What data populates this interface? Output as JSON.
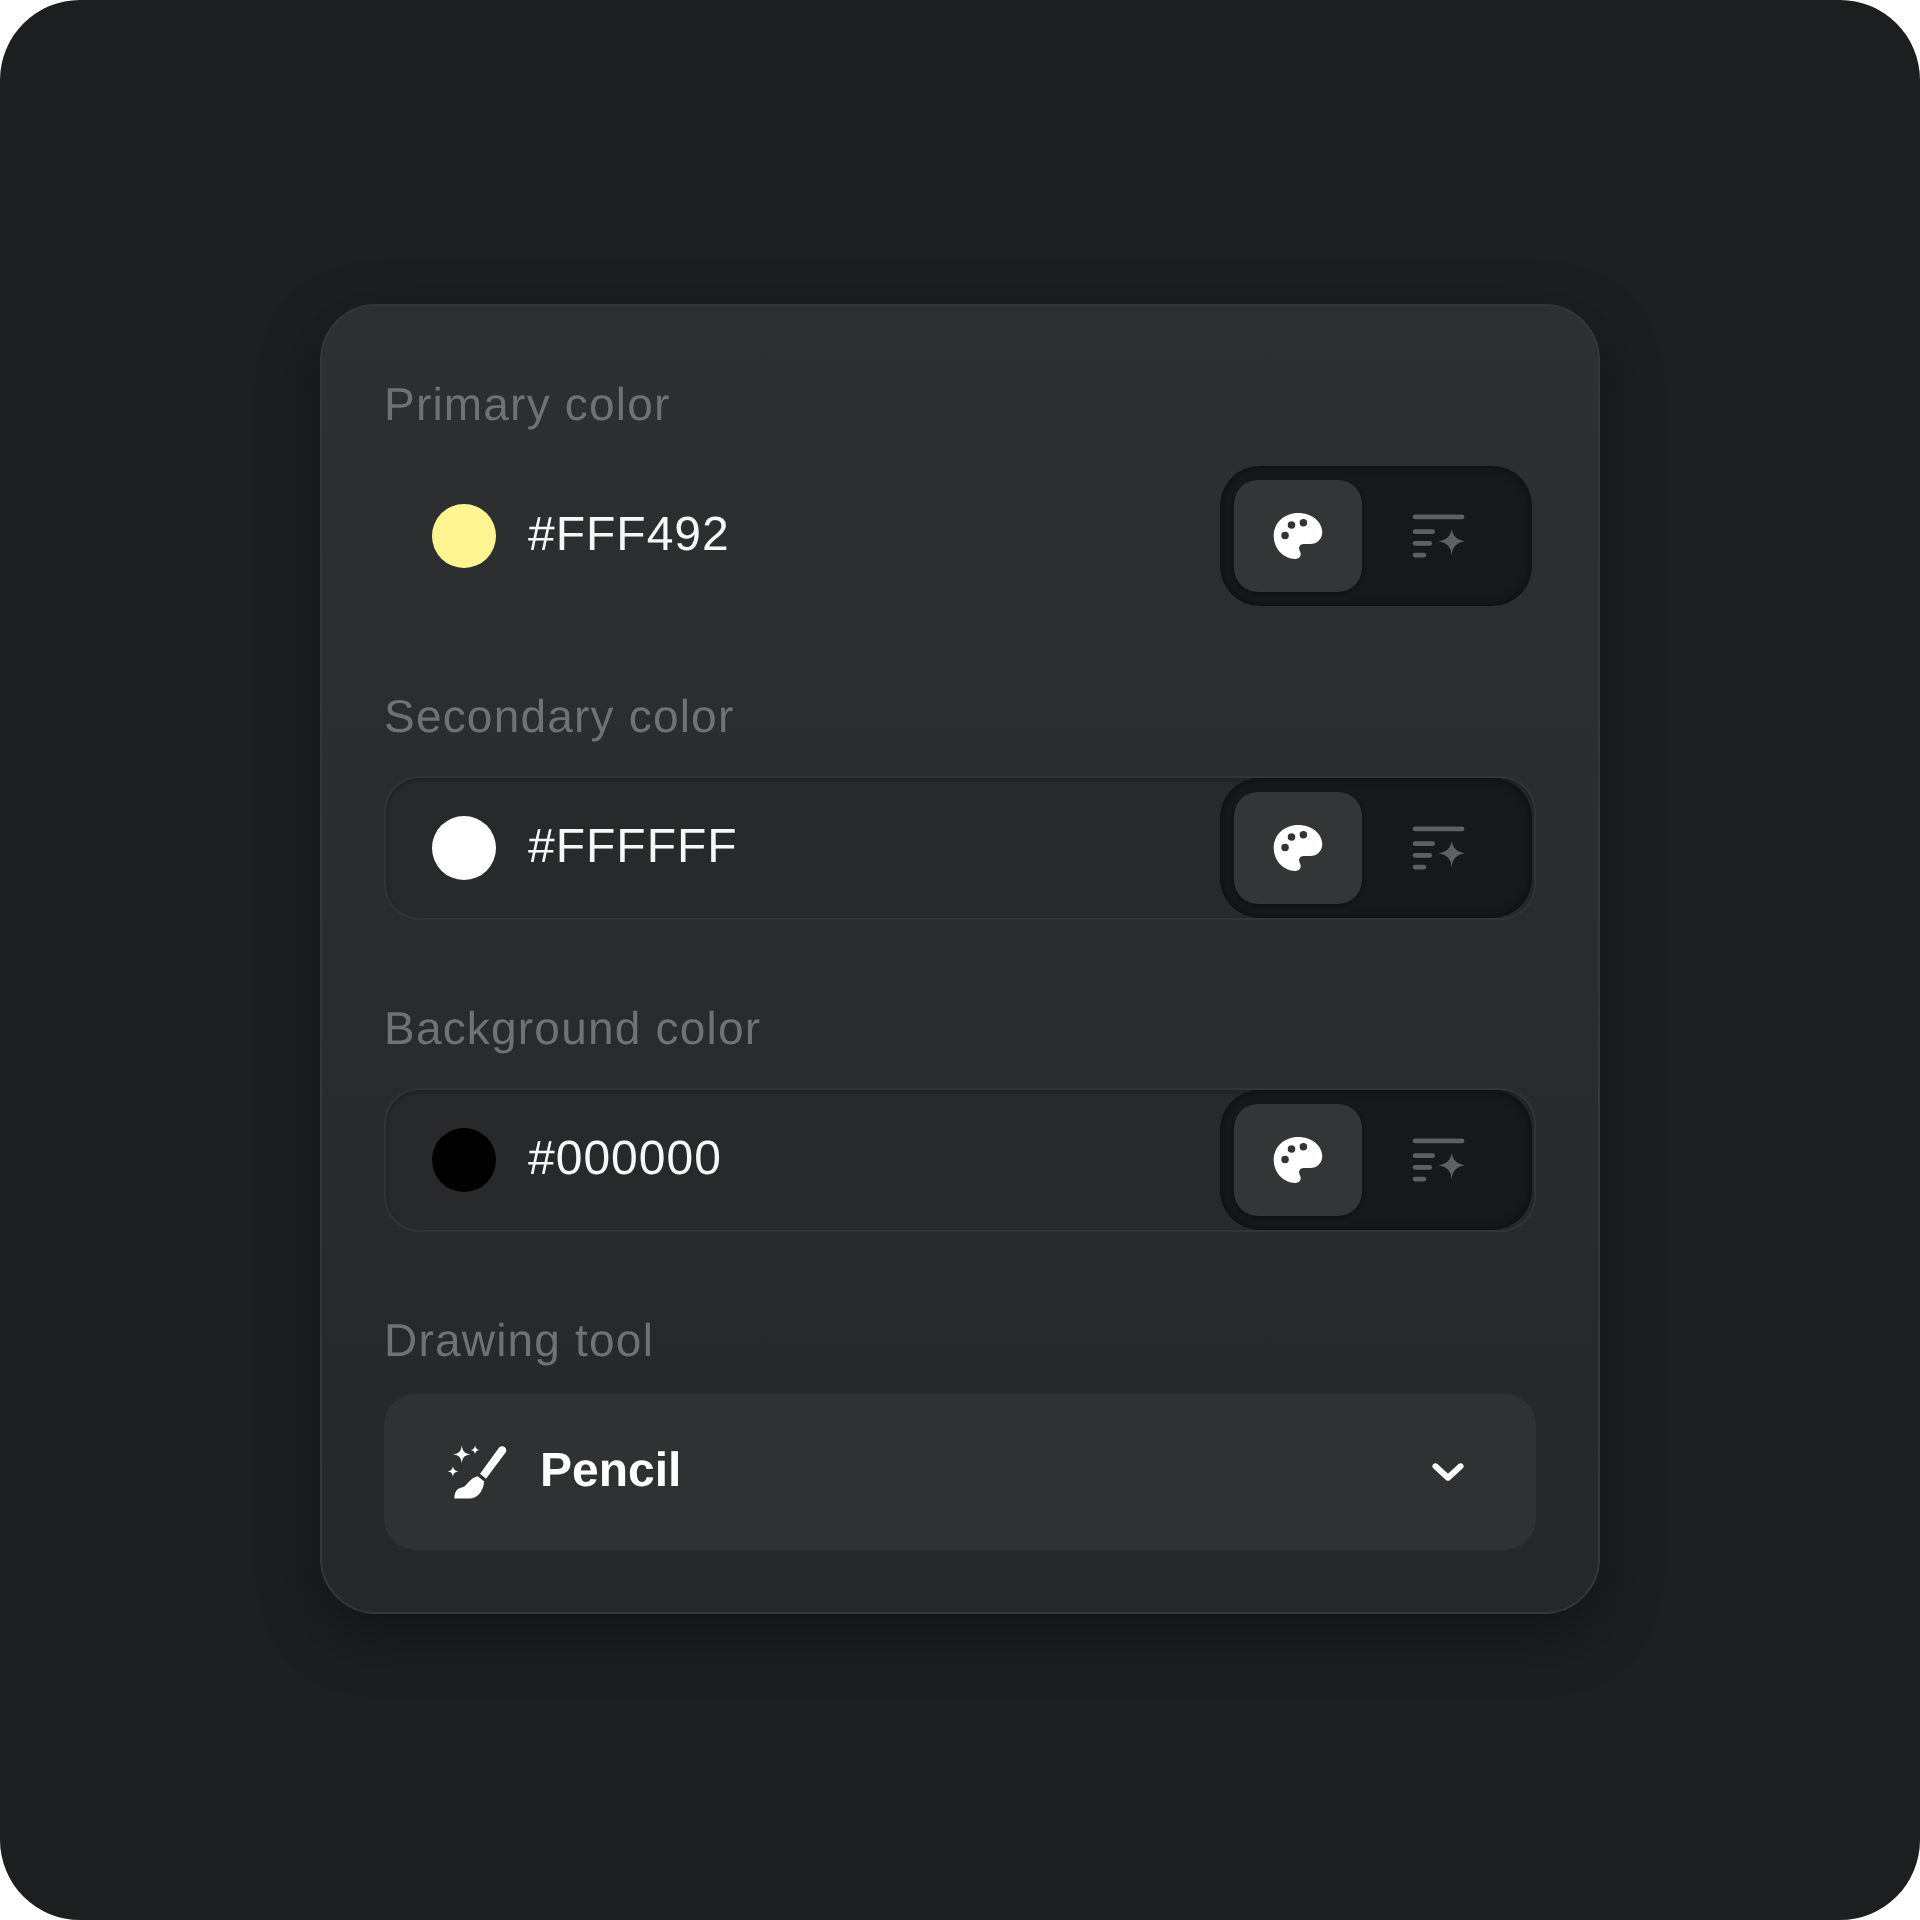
{
  "fields": [
    {
      "label": "Primary color",
      "value": "#FFF492",
      "color": "#fff492",
      "outlined": false,
      "modes": [
        {
          "kind": "palette",
          "selected": true
        },
        {
          "kind": "sparkle-list",
          "selected": false
        }
      ]
    },
    {
      "label": "Secondary color",
      "value": "#FFFFFF",
      "color": "#ffffff",
      "outlined": true,
      "modes": [
        {
          "kind": "palette",
          "selected": true
        },
        {
          "kind": "sparkle-list",
          "selected": false
        }
      ]
    },
    {
      "label": "Background color",
      "value": "#000000",
      "color": "#000000",
      "outlined": true,
      "modes": [
        {
          "kind": "palette",
          "selected": true
        },
        {
          "kind": "sparkle-list",
          "selected": false
        }
      ]
    }
  ],
  "drawing_tool": {
    "label": "Drawing tool",
    "value": "Pencil"
  }
}
